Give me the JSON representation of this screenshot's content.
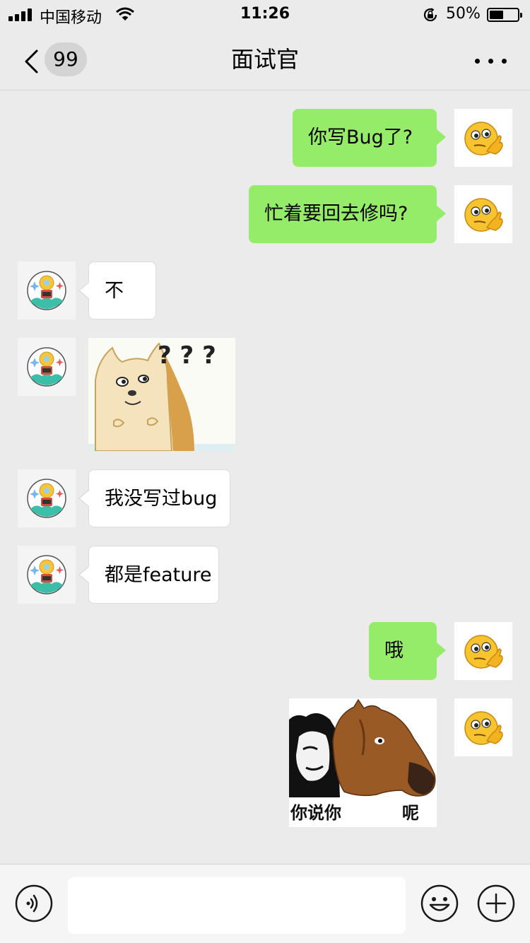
{
  "status_bar": {
    "carrier": "中国移动",
    "time": "11:26",
    "battery_percent": "50%",
    "battery_level": 0.5,
    "signal_icon": "signal-bars-icon",
    "wifi_icon": "wifi-icon",
    "rotation_lock_icon": "rotation-lock-icon"
  },
  "nav": {
    "title": "面试官",
    "unread_count": "99",
    "back_icon": "chevron-left-icon",
    "more_icon": "more-dots-icon"
  },
  "messages": [
    {
      "sender": "me",
      "type": "text",
      "text": "你写Bug了?"
    },
    {
      "sender": "me",
      "type": "text",
      "text": "忙着要回去修吗?"
    },
    {
      "sender": "them",
      "type": "text",
      "text": "不"
    },
    {
      "sender": "them",
      "type": "sticker",
      "sticker": "confused-doge-sticker",
      "caption": "? ? ?"
    },
    {
      "sender": "them",
      "type": "text",
      "text": "我没写过bug"
    },
    {
      "sender": "them",
      "type": "text",
      "text": "都是feature"
    },
    {
      "sender": "me",
      "type": "text",
      "text": "哦"
    },
    {
      "sender": "me",
      "type": "sticker",
      "sticker": "panda-horse-mask-sticker",
      "caption_left": "你说你",
      "caption_right": "呢"
    }
  ],
  "avatars": {
    "me": "thinking-emoji-avatar",
    "them": "rocket-lightbulb-avatar"
  },
  "input_bar": {
    "voice_icon": "voice-icon",
    "emoji_icon": "smiley-icon",
    "plus_icon": "plus-circle-icon",
    "text_value": ""
  },
  "colors": {
    "background": "#ebebeb",
    "my_bubble": "#95ec69",
    "their_bubble": "#ffffff"
  }
}
